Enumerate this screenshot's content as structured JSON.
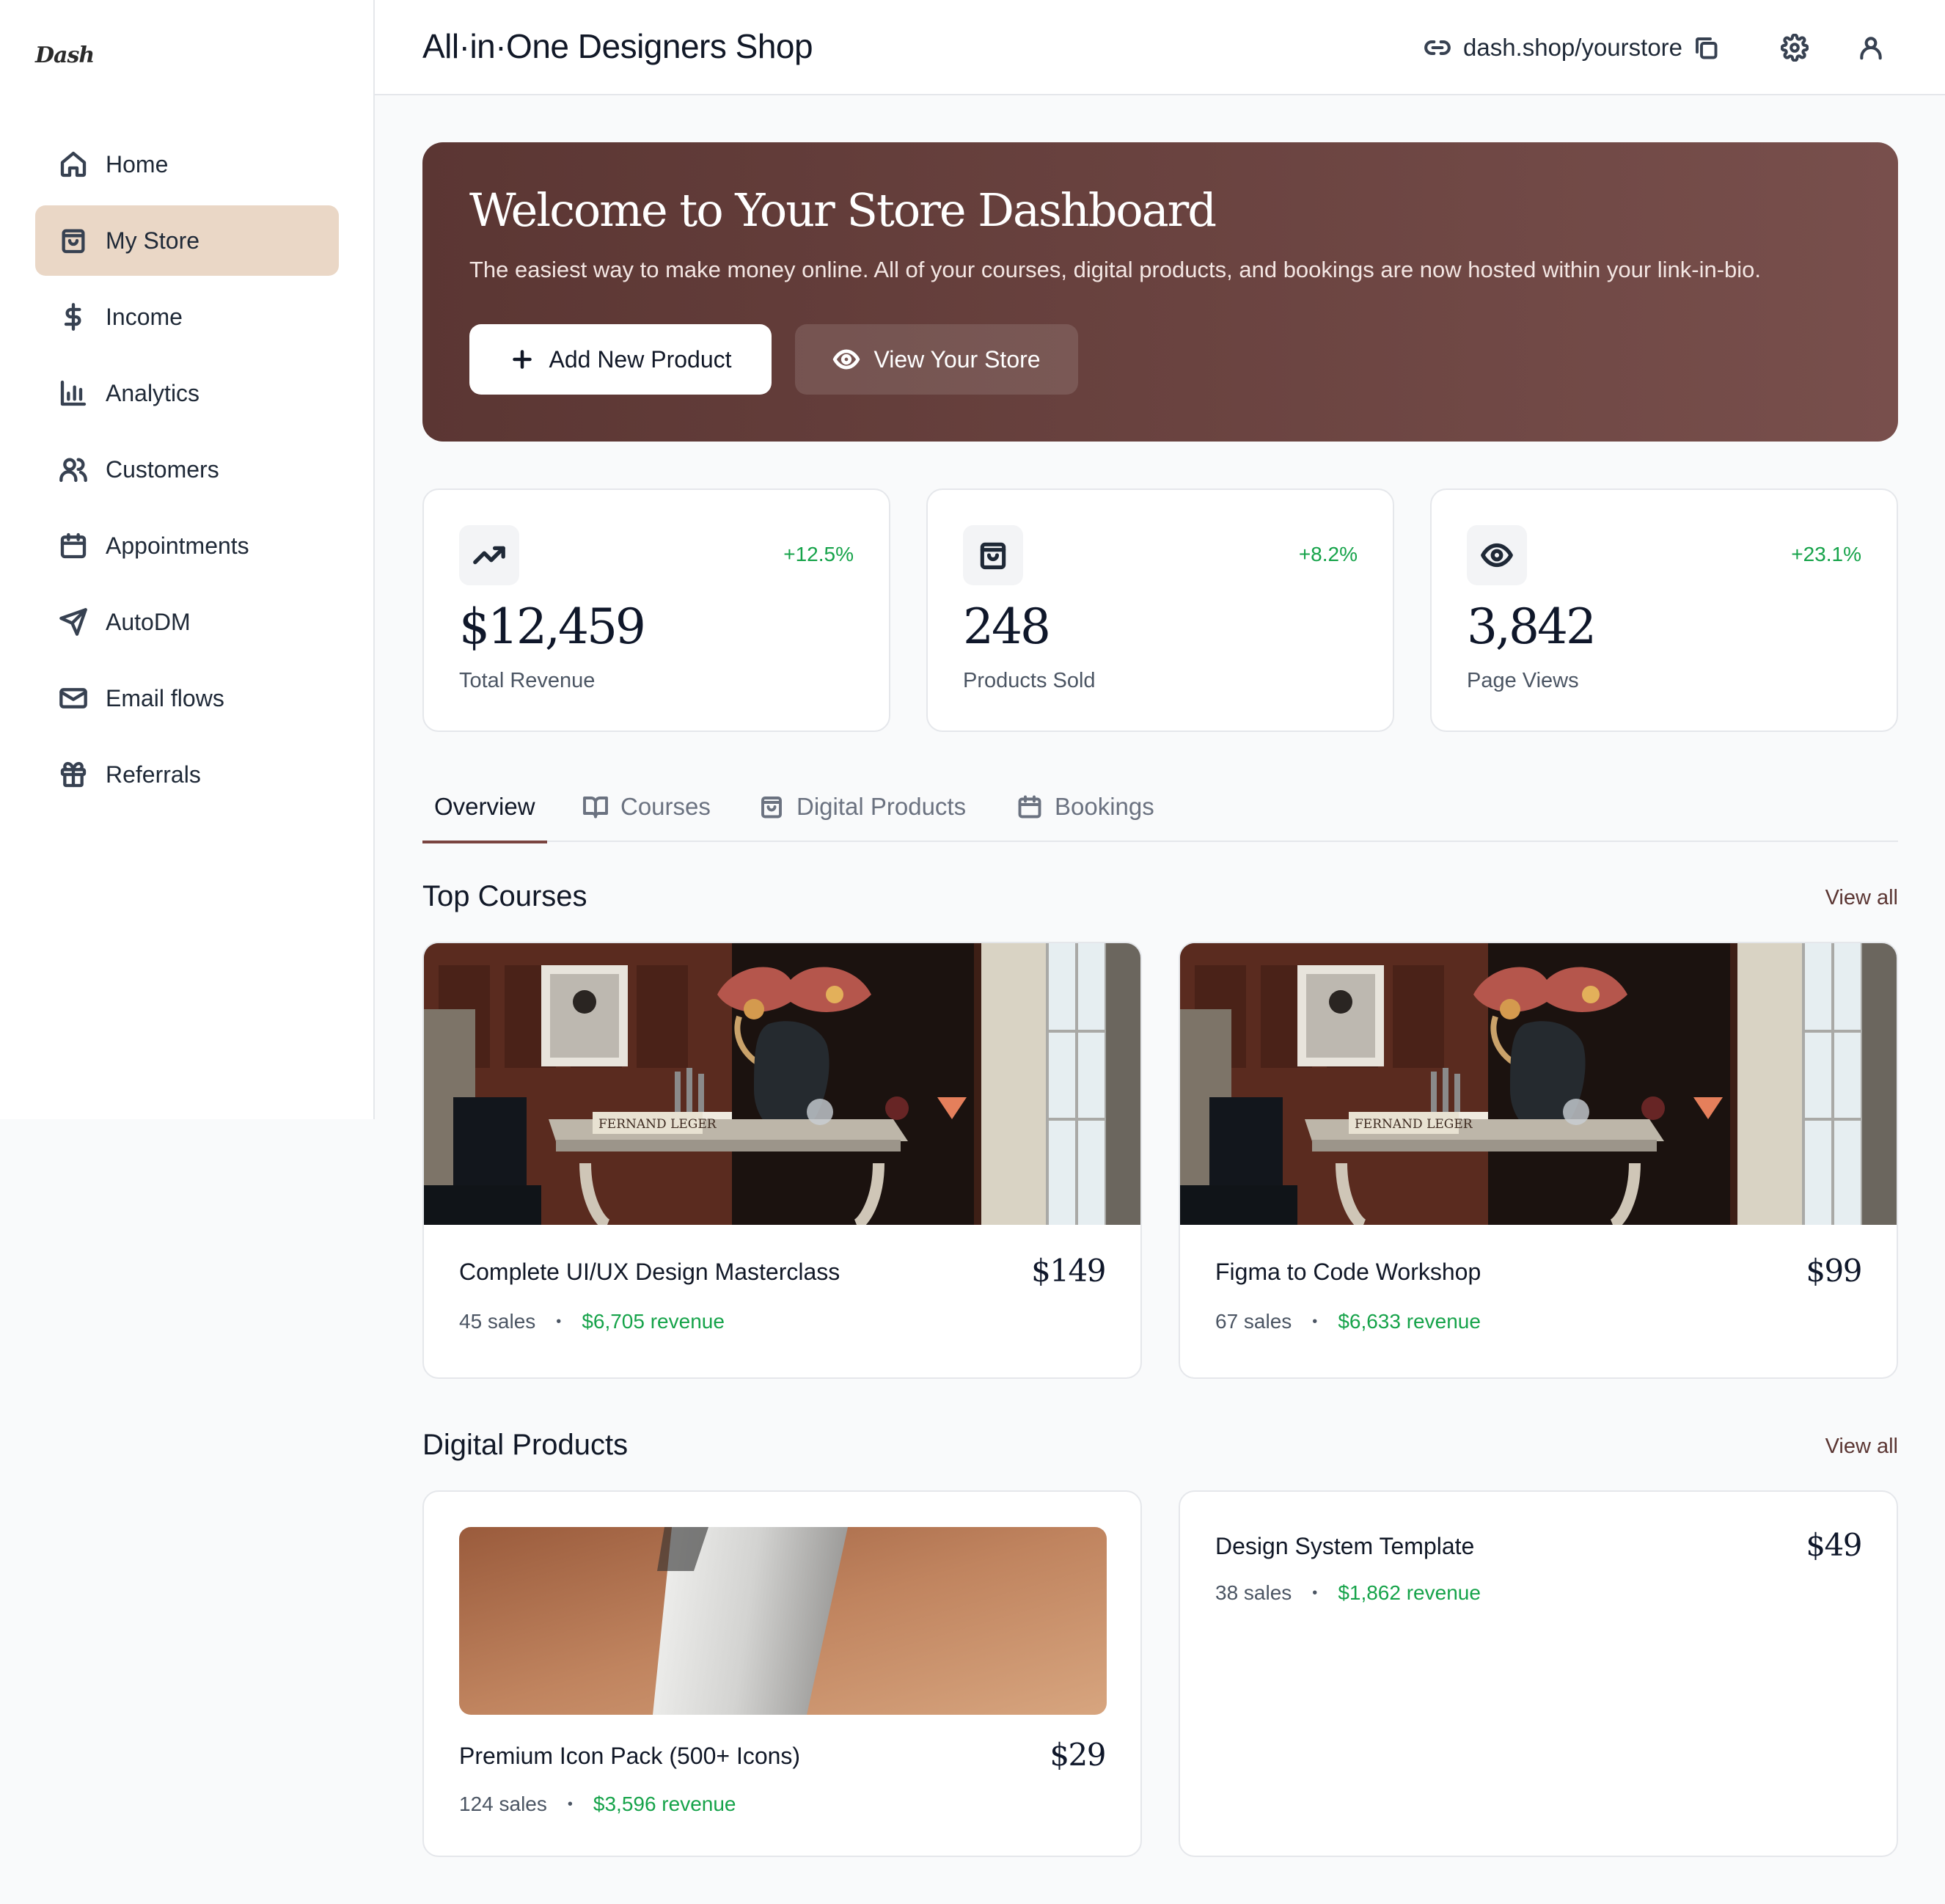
{
  "brand": {
    "logo": "Dash"
  },
  "sidebar": {
    "items": [
      {
        "label": "Home",
        "icon": "home-icon",
        "active": false
      },
      {
        "label": "My Store",
        "icon": "shopping-bag-icon",
        "active": true
      },
      {
        "label": "Income",
        "icon": "dollar-icon",
        "active": false
      },
      {
        "label": "Analytics",
        "icon": "bar-chart-icon",
        "active": false
      },
      {
        "label": "Customers",
        "icon": "users-icon",
        "active": false
      },
      {
        "label": "Appointments",
        "icon": "calendar-icon",
        "active": false
      },
      {
        "label": "AutoDM",
        "icon": "send-icon",
        "active": false
      },
      {
        "label": "Email flows",
        "icon": "mail-icon",
        "active": false
      },
      {
        "label": "Referrals",
        "icon": "gift-icon",
        "active": false
      }
    ]
  },
  "header": {
    "title": "All·in·One Designers Shop",
    "store_url": "dash.shop/yourstore"
  },
  "hero": {
    "title": "Welcome to Your Store Dashboard",
    "subtitle": "The easiest way to make money online. All of your courses, digital products, and bookings are now hosted within your link-in-bio.",
    "primary_button": "Add New Product",
    "secondary_button": "View Your Store"
  },
  "stats": [
    {
      "value": "$12,459",
      "label": "Total Revenue",
      "delta": "+12.5%",
      "icon": "trending-up-icon"
    },
    {
      "value": "248",
      "label": "Products Sold",
      "delta": "+8.2%",
      "icon": "shopping-bag-icon"
    },
    {
      "value": "3,842",
      "label": "Page Views",
      "delta": "+23.1%",
      "icon": "eye-icon"
    }
  ],
  "tabs": [
    {
      "label": "Overview",
      "active": true
    },
    {
      "label": "Courses",
      "icon": "book-icon"
    },
    {
      "label": "Digital Products",
      "icon": "shopping-bag-icon"
    },
    {
      "label": "Bookings",
      "icon": "calendar-icon"
    }
  ],
  "top_courses": {
    "title": "Top Courses",
    "view_all": "View all",
    "items": [
      {
        "title": "Complete UI/UX Design Masterclass",
        "price": "$149",
        "sales": "45 sales",
        "revenue": "$6,705 revenue",
        "book_text": "FERNAND LEGER"
      },
      {
        "title": "Figma to Code Workshop",
        "price": "$99",
        "sales": "67 sales",
        "revenue": "$6,633 revenue",
        "book_text": "FERNAND LEGER"
      }
    ]
  },
  "digital_products": {
    "title": "Digital Products",
    "view_all": "View all",
    "items": [
      {
        "title": "Premium Icon Pack (500+ Icons)",
        "price": "$29",
        "sales": "124 sales",
        "revenue": "$3,596 revenue"
      },
      {
        "title": "Design System Template",
        "price": "$49",
        "sales": "38 sales",
        "revenue": "$1,862 revenue"
      }
    ]
  },
  "colors": {
    "accent": "#5b3633",
    "active_nav": "#ead7c6",
    "positive": "#16a34a"
  }
}
